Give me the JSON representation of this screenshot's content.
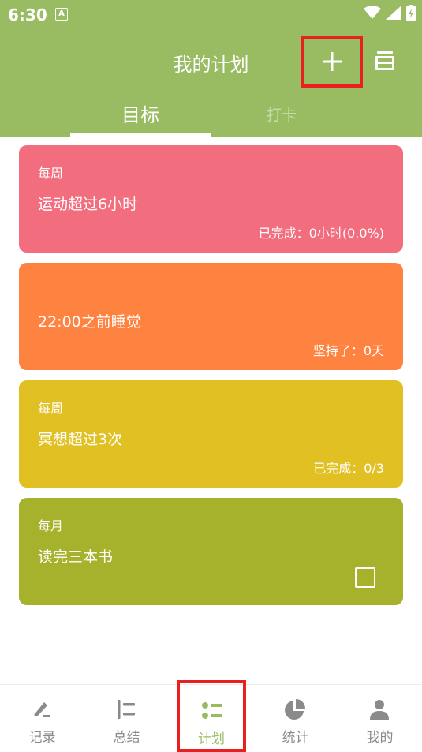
{
  "status_bar": {
    "time": "6:30",
    "badge_letter": "A"
  },
  "header": {
    "title": "我的计划",
    "add_icon": "plus-icon",
    "archive_icon": "archive-icon"
  },
  "tabs": [
    {
      "label": "目标",
      "active": true
    },
    {
      "label": "打卡",
      "active": false
    }
  ],
  "cards": [
    {
      "period": "每周",
      "name": "运动超过6小时",
      "progress": "已完成：0小时(0.0%)",
      "color": "#f26d7d"
    },
    {
      "period": "",
      "name": "22:00之前睡觉",
      "progress": "坚持了：0天",
      "color": "#ff8340"
    },
    {
      "period": "每周",
      "name": "冥想超过3次",
      "progress": "已完成：0/3",
      "color": "#e1c023"
    },
    {
      "period": "每月",
      "name": "读完三本书",
      "progress": "",
      "color": "#a6b22b",
      "checkbox": true
    }
  ],
  "bottom_nav": [
    {
      "label": "记录",
      "icon": "edit-icon"
    },
    {
      "label": "总结",
      "icon": "summary-icon"
    },
    {
      "label": "计划",
      "icon": "plan-list-icon",
      "active": true
    },
    {
      "label": "统计",
      "icon": "pie-chart-icon"
    },
    {
      "label": "我的",
      "icon": "person-icon"
    }
  ],
  "colors": {
    "header": "#99bc63",
    "highlight": "#e8201f",
    "nav_active": "#99bc63",
    "nav_inactive": "#8a8a8a"
  }
}
